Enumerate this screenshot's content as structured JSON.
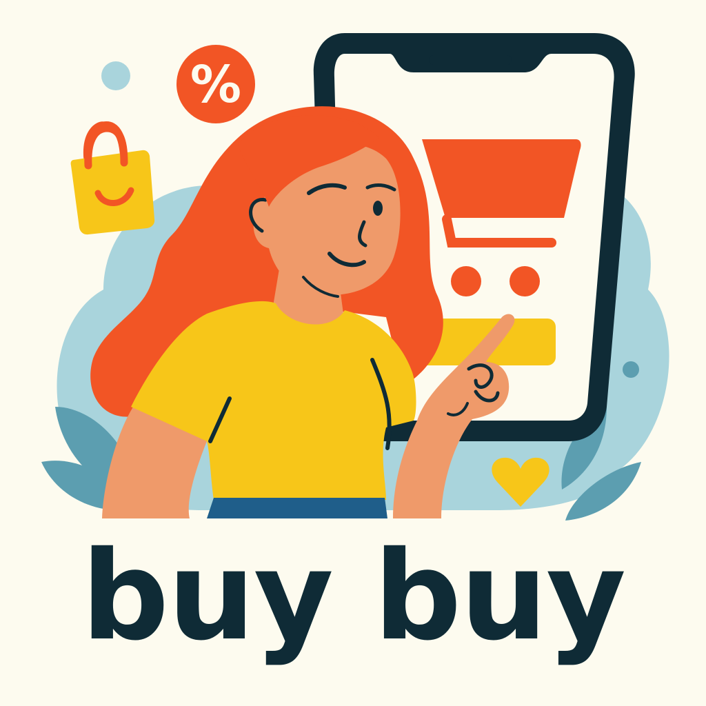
{
  "brand": {
    "name": "buy buy"
  },
  "badge": {
    "symbol": "%"
  },
  "icons": {
    "discount": "percent-badge-icon",
    "bag": "shopping-bag-icon",
    "cart": "shopping-cart-icon",
    "heart": "heart-icon",
    "phone": "smartphone-icon"
  },
  "colors": {
    "background": "#FDFBEF",
    "ink": "#0F2B36",
    "orange": "#F25525",
    "yellow": "#F7C619",
    "skin": "#EF9A6A",
    "pale_blue": "#A9D4DC",
    "teal": "#5C9EB0",
    "jeans": "#1F5E8A"
  }
}
